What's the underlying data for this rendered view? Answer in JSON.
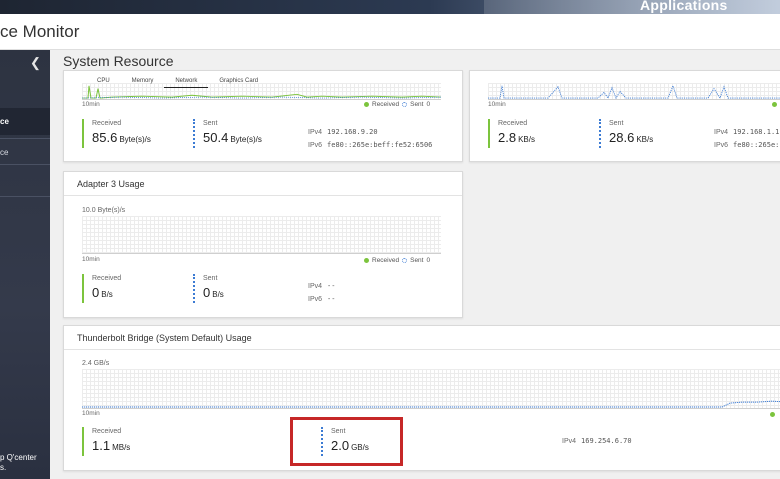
{
  "header": {
    "app_title": "ce Monitor",
    "apps_label": "Applications"
  },
  "sidebar": {
    "items": [
      {
        "label": "ce"
      },
      {
        "label": "ce"
      }
    ],
    "note_line1": "p Q'center",
    "note_line2": "s."
  },
  "main": {
    "title": "System Resource"
  },
  "tabs": [
    "CPU",
    "Memory",
    "Network",
    "Graphics Card"
  ],
  "legend": {
    "received": "Received",
    "sent": "Sent"
  },
  "colors": {
    "received": "#7cc43d",
    "sent": "#3c7bd3",
    "highlight": "#c62828"
  },
  "adapter1": {
    "x_label": "10min",
    "y_right": "0",
    "received_label": "Received",
    "received_value": "85.6",
    "received_unit": "Byte(s)/s",
    "sent_label": "Sent",
    "sent_value": "50.4",
    "sent_unit": "Byte(s)/s",
    "ipv4_key": "IPv4",
    "ipv4": "192.168.9.20",
    "ipv6_key": "IPv6",
    "ipv6": "fe80::265e:beff:fe52:6506"
  },
  "adapter2": {
    "x_label": "10min",
    "received_label": "Received",
    "received_value": "2.8",
    "received_unit": "KB/s",
    "sent_label": "Sent",
    "sent_value": "28.6",
    "sent_unit": "KB/s",
    "ipv4_key": "IPv4",
    "ipv4": "192.168.1.1",
    "ipv6_key": "IPv6",
    "ipv6": "fe80::265e:"
  },
  "adapter3": {
    "title": "Adapter 3 Usage",
    "y_max": "10.0 Byte(s)/s",
    "x_label": "10min",
    "y_right": "0",
    "received_label": "Received",
    "received_value": "0",
    "received_unit": "B/s",
    "sent_label": "Sent",
    "sent_value": "0",
    "sent_unit": "B/s",
    "ipv4_key": "IPv4",
    "ipv4": "--",
    "ipv6_key": "IPv6",
    "ipv6": "--"
  },
  "thunderbolt": {
    "title": "Thunderbolt Bridge (System Default) Usage",
    "y_max": "2.4 GB/s",
    "x_label": "10min",
    "received_label": "Received",
    "received_value": "1.1",
    "received_unit": "MB/s",
    "sent_label": "Sent",
    "sent_value": "2.0",
    "sent_unit": "GB/s",
    "ipv4_key": "IPv4",
    "ipv4": "169.254.6.70"
  }
}
